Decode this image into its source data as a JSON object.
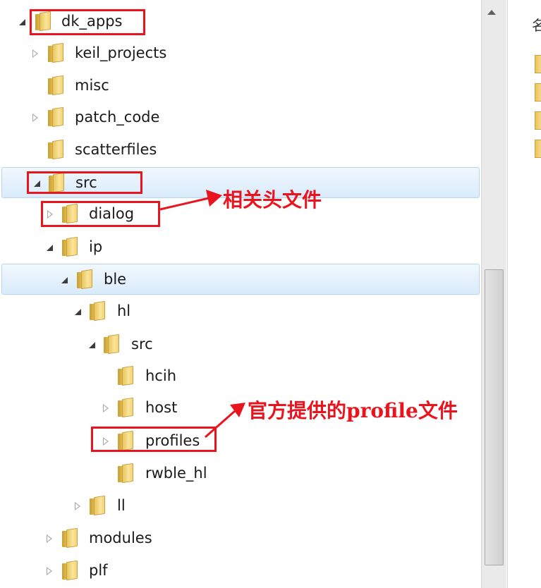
{
  "tree": {
    "items": [
      {
        "label": "dk_apps",
        "state": "expanded"
      },
      {
        "label": "keil_projects",
        "state": "collapsed"
      },
      {
        "label": "misc",
        "state": "none"
      },
      {
        "label": "patch_code",
        "state": "collapsed"
      },
      {
        "label": "scatterfiles",
        "state": "none"
      },
      {
        "label": "src",
        "state": "expanded",
        "selected": true
      },
      {
        "label": "dialog",
        "state": "collapsed"
      },
      {
        "label": "ip",
        "state": "expanded"
      },
      {
        "label": "ble",
        "state": "expanded",
        "selected": true
      },
      {
        "label": "hl",
        "state": "expanded"
      },
      {
        "label": "src",
        "state": "expanded"
      },
      {
        "label": "hcih",
        "state": "none"
      },
      {
        "label": "host",
        "state": "collapsed"
      },
      {
        "label": "profiles",
        "state": "collapsed"
      },
      {
        "label": "rwble_hl",
        "state": "none"
      },
      {
        "label": "ll",
        "state": "collapsed"
      },
      {
        "label": "modules",
        "state": "collapsed"
      },
      {
        "label": "plf",
        "state": "collapsed"
      }
    ]
  },
  "annotations": {
    "dialog_note": "相关头文件",
    "profiles_note": "官方提供的profile文件"
  },
  "right_pane": {
    "heading_char": "名"
  },
  "colors": {
    "annotation_red": "#e8141e",
    "selection_border": "#b6d5f1",
    "folder_yellow": "#f3d278"
  },
  "icons": [
    "folder-icon",
    "expand-arrow-icon",
    "collapse-arrow-icon",
    "scroll-up-icon"
  ]
}
